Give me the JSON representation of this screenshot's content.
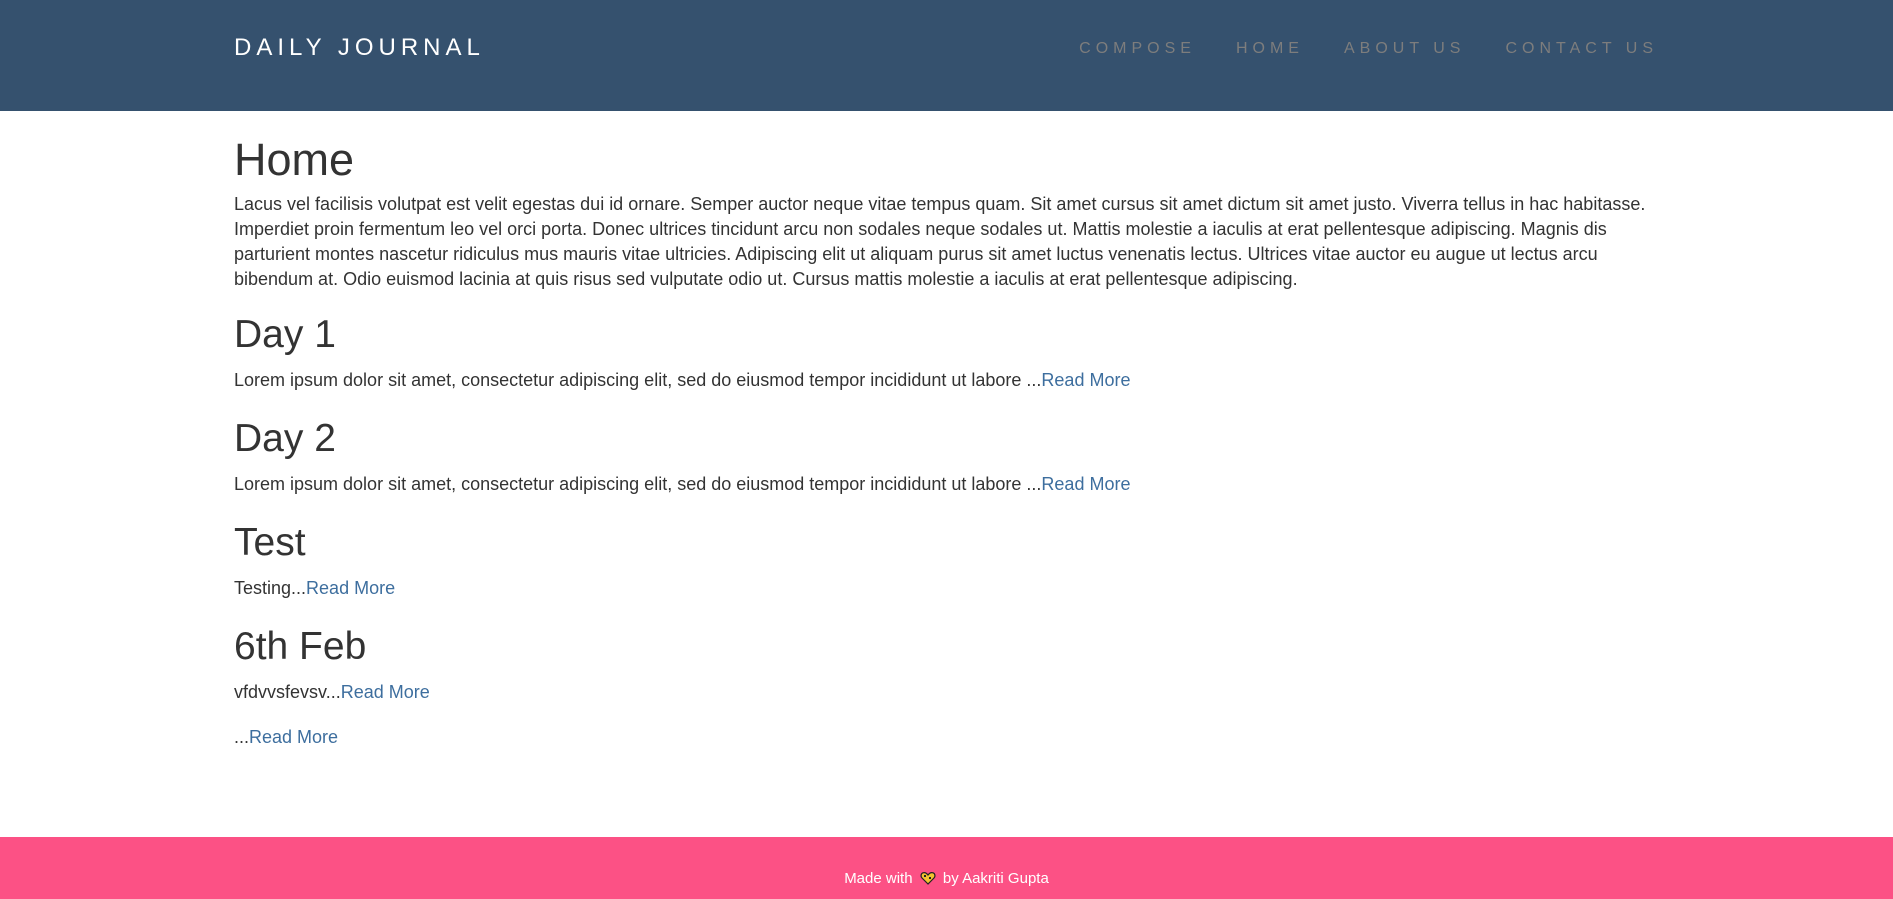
{
  "header": {
    "brand": "DAILY JOURNAL",
    "nav": [
      {
        "label": "COMPOSE"
      },
      {
        "label": "HOME"
      },
      {
        "label": "ABOUT US"
      },
      {
        "label": "CONTACT US"
      }
    ]
  },
  "main": {
    "title": "Home",
    "intro": "Lacus vel facilisis volutpat est velit egestas dui id ornare. Semper auctor neque vitae tempus quam. Sit amet cursus sit amet dictum sit amet justo. Viverra tellus in hac habitasse. Imperdiet proin fermentum leo vel orci porta. Donec ultrices tincidunt arcu non sodales neque sodales ut. Mattis molestie a iaculis at erat pellentesque adipiscing. Magnis dis parturient montes nascetur ridiculus mus mauris vitae ultricies. Adipiscing elit ut aliquam purus sit amet luctus venenatis lectus. Ultrices vitae auctor eu augue ut lectus arcu bibendum at. Odio euismod lacinia at quis risus sed vulputate odio ut. Cursus mattis molestie a iaculis at erat pellentesque adipiscing.",
    "posts": [
      {
        "title": "Day 1",
        "excerpt": "Lorem ipsum dolor sit amet, consectetur adipiscing elit, sed do eiusmod tempor incididunt ut labore ...",
        "link": "Read More"
      },
      {
        "title": "Day 2",
        "excerpt": "Lorem ipsum dolor sit amet, consectetur adipiscing elit, sed do eiusmod tempor incididunt ut labore ...",
        "link": "Read More"
      },
      {
        "title": "Test",
        "excerpt": "Testing...",
        "link": "Read More"
      },
      {
        "title": "6th Feb",
        "excerpt": "vfdvvsfevsv...",
        "link": "Read More"
      },
      {
        "title": "",
        "excerpt": "...",
        "link": "Read More"
      }
    ]
  },
  "footer": {
    "prefix": "Made with",
    "suffix": "by Aakriti Gupta",
    "icon": "heart-icon"
  },
  "colors": {
    "navbar": "#35516e",
    "footer": "#fc5185",
    "link": "#3d6e9e"
  }
}
